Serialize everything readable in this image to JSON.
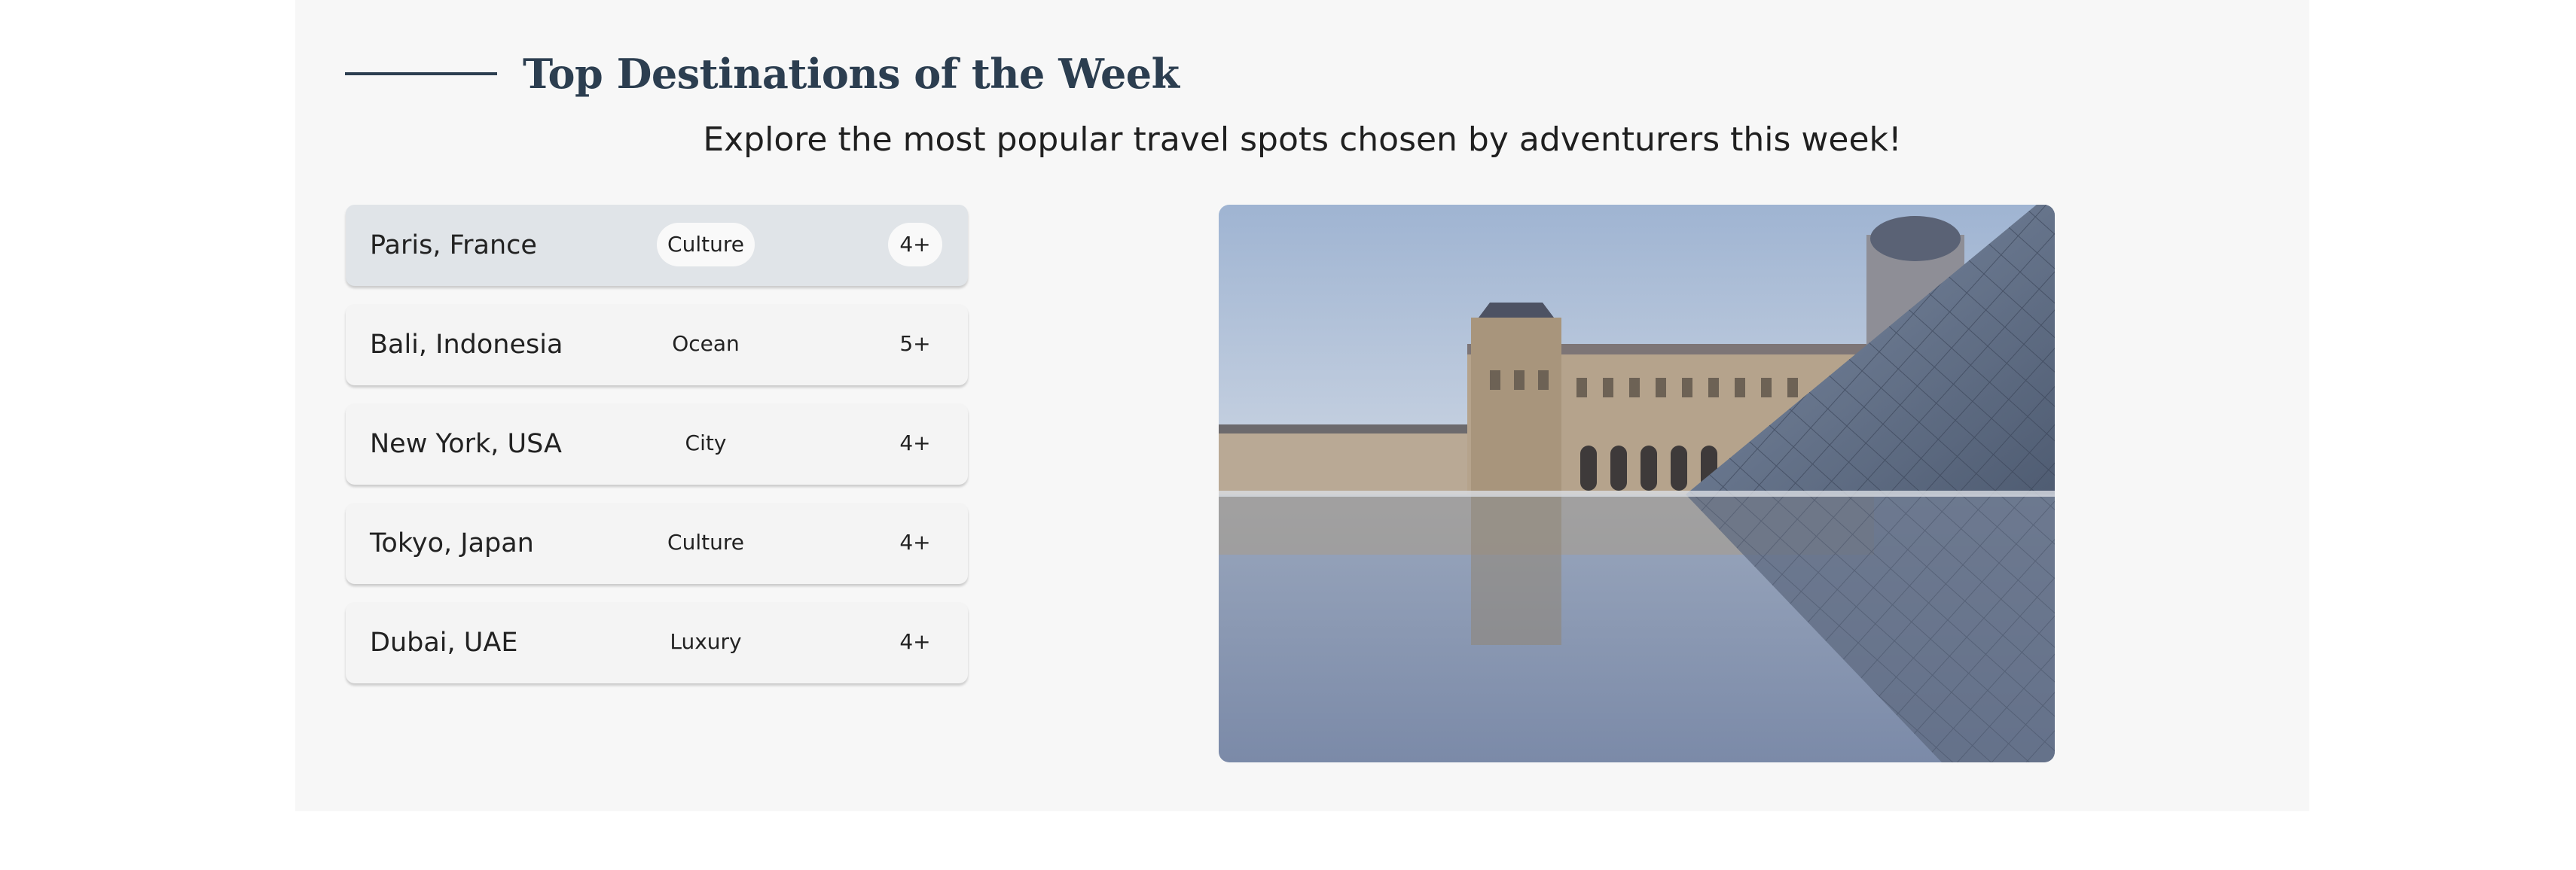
{
  "section": {
    "title": "Top Destinations of the Week",
    "subtitle": "Explore the most popular travel spots chosen by adventurers this week!"
  },
  "destinations": [
    {
      "name": "Paris, France",
      "tag": "Culture",
      "count": "4+",
      "active": true
    },
    {
      "name": "Bali, Indonesia",
      "tag": "Ocean",
      "count": "5+",
      "active": false
    },
    {
      "name": "New York, USA",
      "tag": "City",
      "count": "4+",
      "active": false
    },
    {
      "name": "Tokyo, Japan",
      "tag": "Culture",
      "count": "4+",
      "active": false
    },
    {
      "name": "Dubai, UAE",
      "tag": "Luxury",
      "count": "4+",
      "active": false
    }
  ],
  "colors": {
    "panel_background": "#f7f7f7",
    "title_color": "#2c3e50",
    "active_item_background": "#e0e4e8",
    "item_background": "#f4f4f4"
  }
}
